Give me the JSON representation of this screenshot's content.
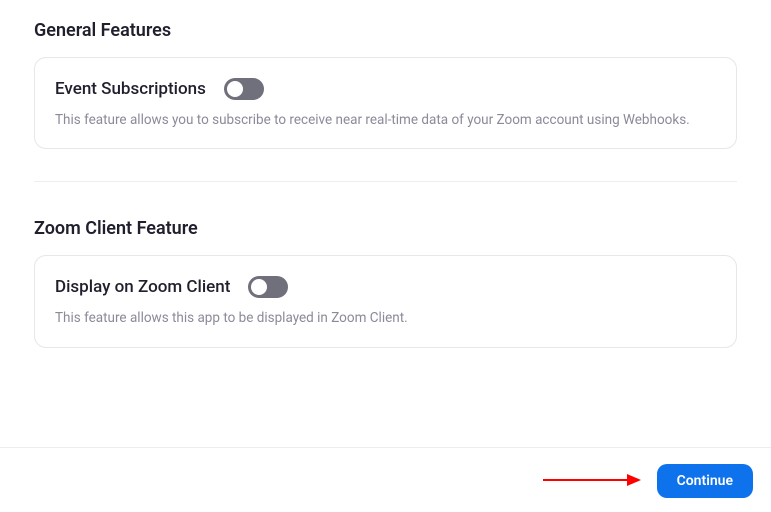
{
  "sections": {
    "general": {
      "title": "General Features",
      "feature": {
        "name": "Event Subscriptions",
        "description": "This feature allows you to subscribe to receive near real-time data of your Zoom account using Webhooks.",
        "toggle_on": false
      }
    },
    "zoom_client": {
      "title": "Zoom Client Feature",
      "feature": {
        "name": "Display on Zoom Client",
        "description": "This feature allows this app to be displayed in Zoom Client.",
        "toggle_on": false
      }
    }
  },
  "footer": {
    "continue_label": "Continue"
  },
  "annotation": {
    "arrow_color": "#ff0000"
  }
}
